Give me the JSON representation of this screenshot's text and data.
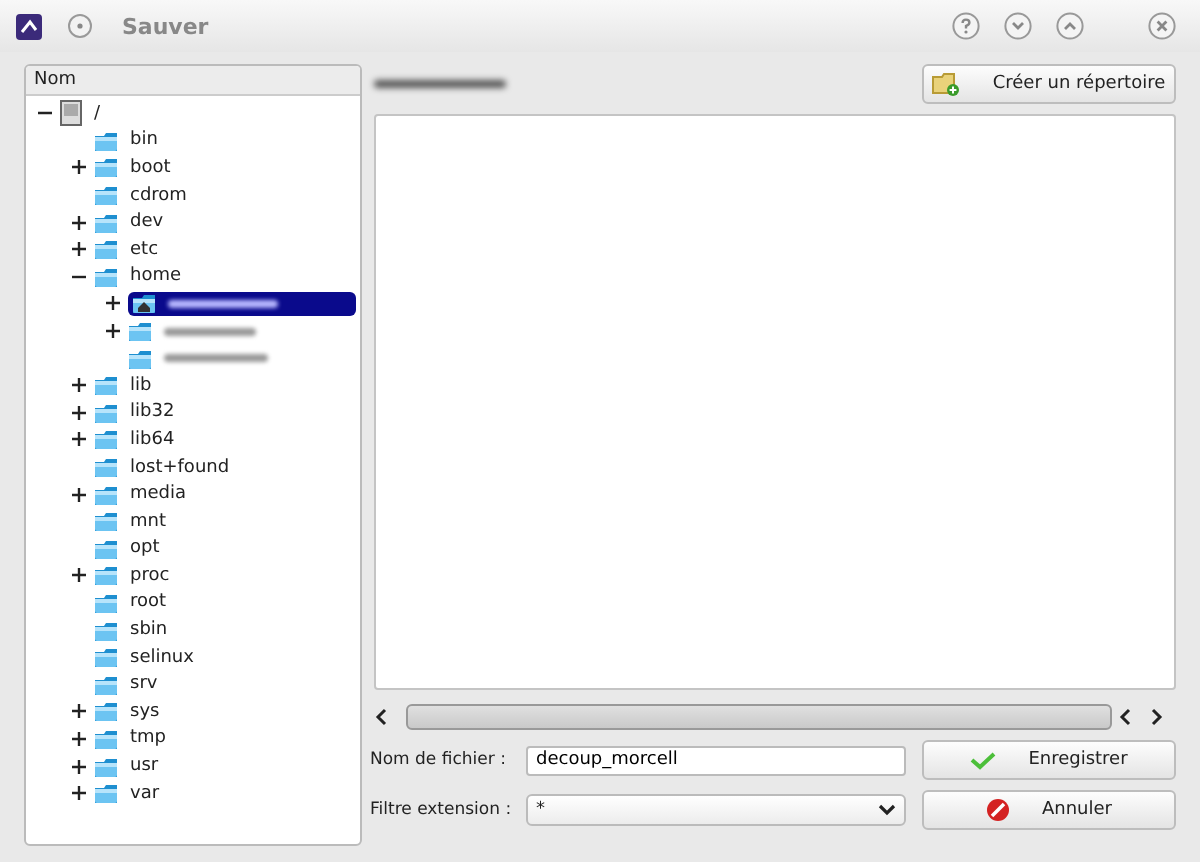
{
  "window": {
    "title": "Sauver"
  },
  "tree": {
    "column": "Nom",
    "items": [
      {
        "label": "/",
        "kind": "drive",
        "expandable": true,
        "expanded": true,
        "selected": false,
        "children": [
          {
            "label": "bin",
            "kind": "folder",
            "expandable": false,
            "selected": false
          },
          {
            "label": "boot",
            "kind": "folder",
            "expandable": true,
            "expanded": false,
            "selected": false
          },
          {
            "label": "cdrom",
            "kind": "folder",
            "expandable": false,
            "selected": false
          },
          {
            "label": "dev",
            "kind": "folder",
            "expandable": true,
            "expanded": false,
            "selected": false
          },
          {
            "label": "etc",
            "kind": "folder",
            "expandable": true,
            "expanded": false,
            "selected": false
          },
          {
            "label": "home",
            "kind": "folder",
            "expandable": true,
            "expanded": true,
            "selected": false,
            "children": [
              {
                "kind": "home",
                "redacted": true,
                "expandable": true,
                "expanded": false,
                "selected": true
              },
              {
                "kind": "folder",
                "redacted": true,
                "expandable": true,
                "expanded": false,
                "selected": false
              },
              {
                "kind": "folder",
                "redacted": true,
                "expandable": false,
                "selected": false
              }
            ]
          },
          {
            "label": "lib",
            "kind": "folder",
            "expandable": true,
            "expanded": false,
            "selected": false
          },
          {
            "label": "lib32",
            "kind": "folder",
            "expandable": true,
            "expanded": false,
            "selected": false
          },
          {
            "label": "lib64",
            "kind": "folder",
            "expandable": true,
            "expanded": false,
            "selected": false
          },
          {
            "label": "lost+found",
            "kind": "folder",
            "expandable": false,
            "selected": false
          },
          {
            "label": "media",
            "kind": "folder",
            "expandable": true,
            "expanded": false,
            "selected": false
          },
          {
            "label": "mnt",
            "kind": "folder",
            "expandable": false,
            "selected": false
          },
          {
            "label": "opt",
            "kind": "folder",
            "expandable": false,
            "selected": false
          },
          {
            "label": "proc",
            "kind": "folder",
            "expandable": true,
            "expanded": false,
            "selected": false
          },
          {
            "label": "root",
            "kind": "folder",
            "expandable": false,
            "selected": false
          },
          {
            "label": "sbin",
            "kind": "folder",
            "expandable": false,
            "selected": false
          },
          {
            "label": "selinux",
            "kind": "folder",
            "expandable": false,
            "selected": false
          },
          {
            "label": "srv",
            "kind": "folder",
            "expandable": false,
            "selected": false
          },
          {
            "label": "sys",
            "kind": "folder",
            "expandable": true,
            "expanded": false,
            "selected": false
          },
          {
            "label": "tmp",
            "kind": "folder",
            "expandable": true,
            "expanded": false,
            "selected": false
          },
          {
            "label": "usr",
            "kind": "folder",
            "expandable": true,
            "expanded": false,
            "selected": false
          },
          {
            "label": "var",
            "kind": "folder",
            "expandable": true,
            "expanded": false,
            "selected": false
          }
        ]
      }
    ]
  },
  "create_folder_button": "Créer un répertoire",
  "filename": {
    "label": "Nom de fichier :",
    "value": "decoup_morcell"
  },
  "filter": {
    "label": "Filtre extension :",
    "value": "*"
  },
  "buttons": [
    {
      "label": "Enregistrer",
      "kind": "save"
    },
    {
      "label": "Annuler",
      "kind": "cancel"
    }
  ]
}
